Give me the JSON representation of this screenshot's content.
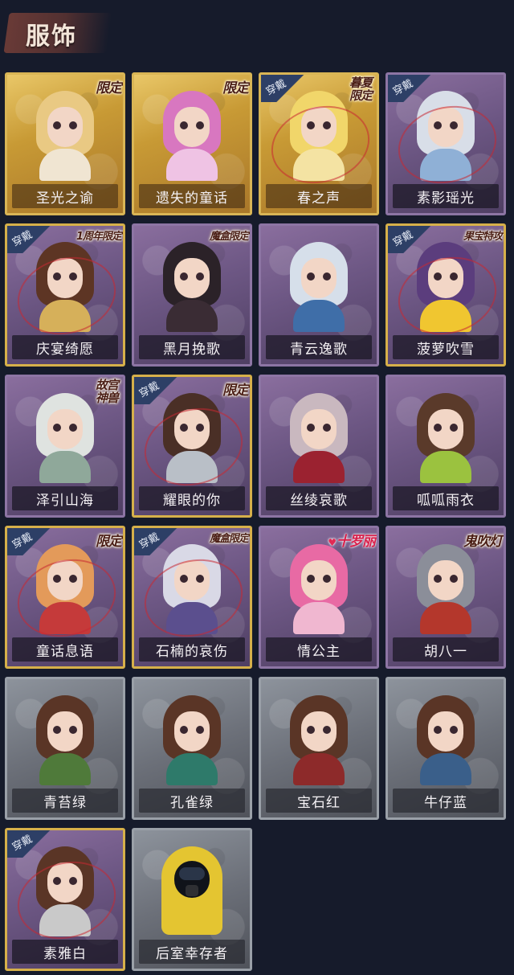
{
  "header": {
    "title": "服饰"
  },
  "badge_text": "穿戴",
  "cards": [
    {
      "name": "圣光之谕",
      "frame": "gold",
      "tag": "限定",
      "wearing": false,
      "hair": "#e9c983",
      "outfit": "#f0e5d2"
    },
    {
      "name": "遗失的童话",
      "frame": "gold",
      "tag": "限定",
      "wearing": false,
      "hair": "#d877c0",
      "outfit": "#efc3e4"
    },
    {
      "name": "春之声",
      "frame": "gold",
      "tag": "暮夏限定",
      "wearing": true,
      "hair": "#f1d66a",
      "outfit": "#f4e3a3"
    },
    {
      "name": "素影瑶光",
      "frame": "purple",
      "tag": "",
      "wearing": true,
      "hair": "#d8dee8",
      "outfit": "#8fb0d6"
    },
    {
      "name": "庆宴绮愿",
      "frame": "purple-gold",
      "tag": "1周年限定",
      "wearing": true,
      "hair": "#5d3524",
      "outfit": "#d6b05a"
    },
    {
      "name": "黑月挽歌",
      "frame": "purple",
      "tag": "魔盒限定",
      "wearing": false,
      "hair": "#2b2228",
      "outfit": "#3a2c34"
    },
    {
      "name": "青云逸歌",
      "frame": "purple",
      "tag": "",
      "wearing": false,
      "hair": "#d6dfea",
      "outfit": "#3f6ea8"
    },
    {
      "name": "菠萝吹雪",
      "frame": "purple-gold",
      "tag": "果宝特攻",
      "wearing": true,
      "hair": "#5b3d7d",
      "outfit": "#f0c630"
    },
    {
      "name": "泽引山海",
      "frame": "purple",
      "tag": "故宫神兽",
      "wearing": false,
      "hair": "#dfe3e0",
      "outfit": "#8fa89a"
    },
    {
      "name": "耀眼的你",
      "frame": "purple-gold",
      "tag": "限定",
      "wearing": true,
      "hair": "#4a2f26",
      "outfit": "#b9bfc7"
    },
    {
      "name": "丝绫哀歌",
      "frame": "purple",
      "tag": "",
      "wearing": false,
      "hair": "#c9b8bf",
      "outfit": "#9b2230"
    },
    {
      "name": "呱呱雨衣",
      "frame": "purple",
      "tag": "",
      "wearing": false,
      "hair": "#5a3a2a",
      "outfit": "#9bc23f"
    },
    {
      "name": "童话息语",
      "frame": "purple-gold",
      "tag": "限定",
      "wearing": true,
      "hair": "#e39a5a",
      "outfit": "#c53a3a"
    },
    {
      "name": "石楠的哀伤",
      "frame": "purple-gold",
      "tag": "魔盒限定",
      "wearing": true,
      "hair": "#d9d9e6",
      "outfit": "#5b4f8e"
    },
    {
      "name": "情公主",
      "frame": "purple",
      "tag": "十罗丽",
      "wearing": false,
      "hair": "#e86aa4",
      "outfit": "#f0b7d0"
    },
    {
      "name": "胡八一",
      "frame": "purple",
      "tag": "鬼吹灯",
      "wearing": false,
      "hair": "#8b8e99",
      "outfit": "#b4372c"
    },
    {
      "name": "青苔绿",
      "frame": "gray",
      "tag": "",
      "wearing": false,
      "hair": "#5a3526",
      "outfit": "#4f7a3a"
    },
    {
      "name": "孔雀绿",
      "frame": "gray",
      "tag": "",
      "wearing": false,
      "hair": "#5a3526",
      "outfit": "#2e7a6a"
    },
    {
      "name": "宝石红",
      "frame": "gray",
      "tag": "",
      "wearing": false,
      "hair": "#5a3526",
      "outfit": "#8d2a2a"
    },
    {
      "name": "牛仔蓝",
      "frame": "gray",
      "tag": "",
      "wearing": false,
      "hair": "#5a3526",
      "outfit": "#3a5f8a"
    },
    {
      "name": "素雅白",
      "frame": "purple-gold",
      "tag": "",
      "wearing": true,
      "hair": "#5a3526",
      "outfit": "#c9c9c9"
    },
    {
      "name": "后室幸存者",
      "frame": "gray",
      "tag": "",
      "wearing": false,
      "hair": "#e4c531",
      "outfit": "#e4c531",
      "survivor": true
    }
  ]
}
